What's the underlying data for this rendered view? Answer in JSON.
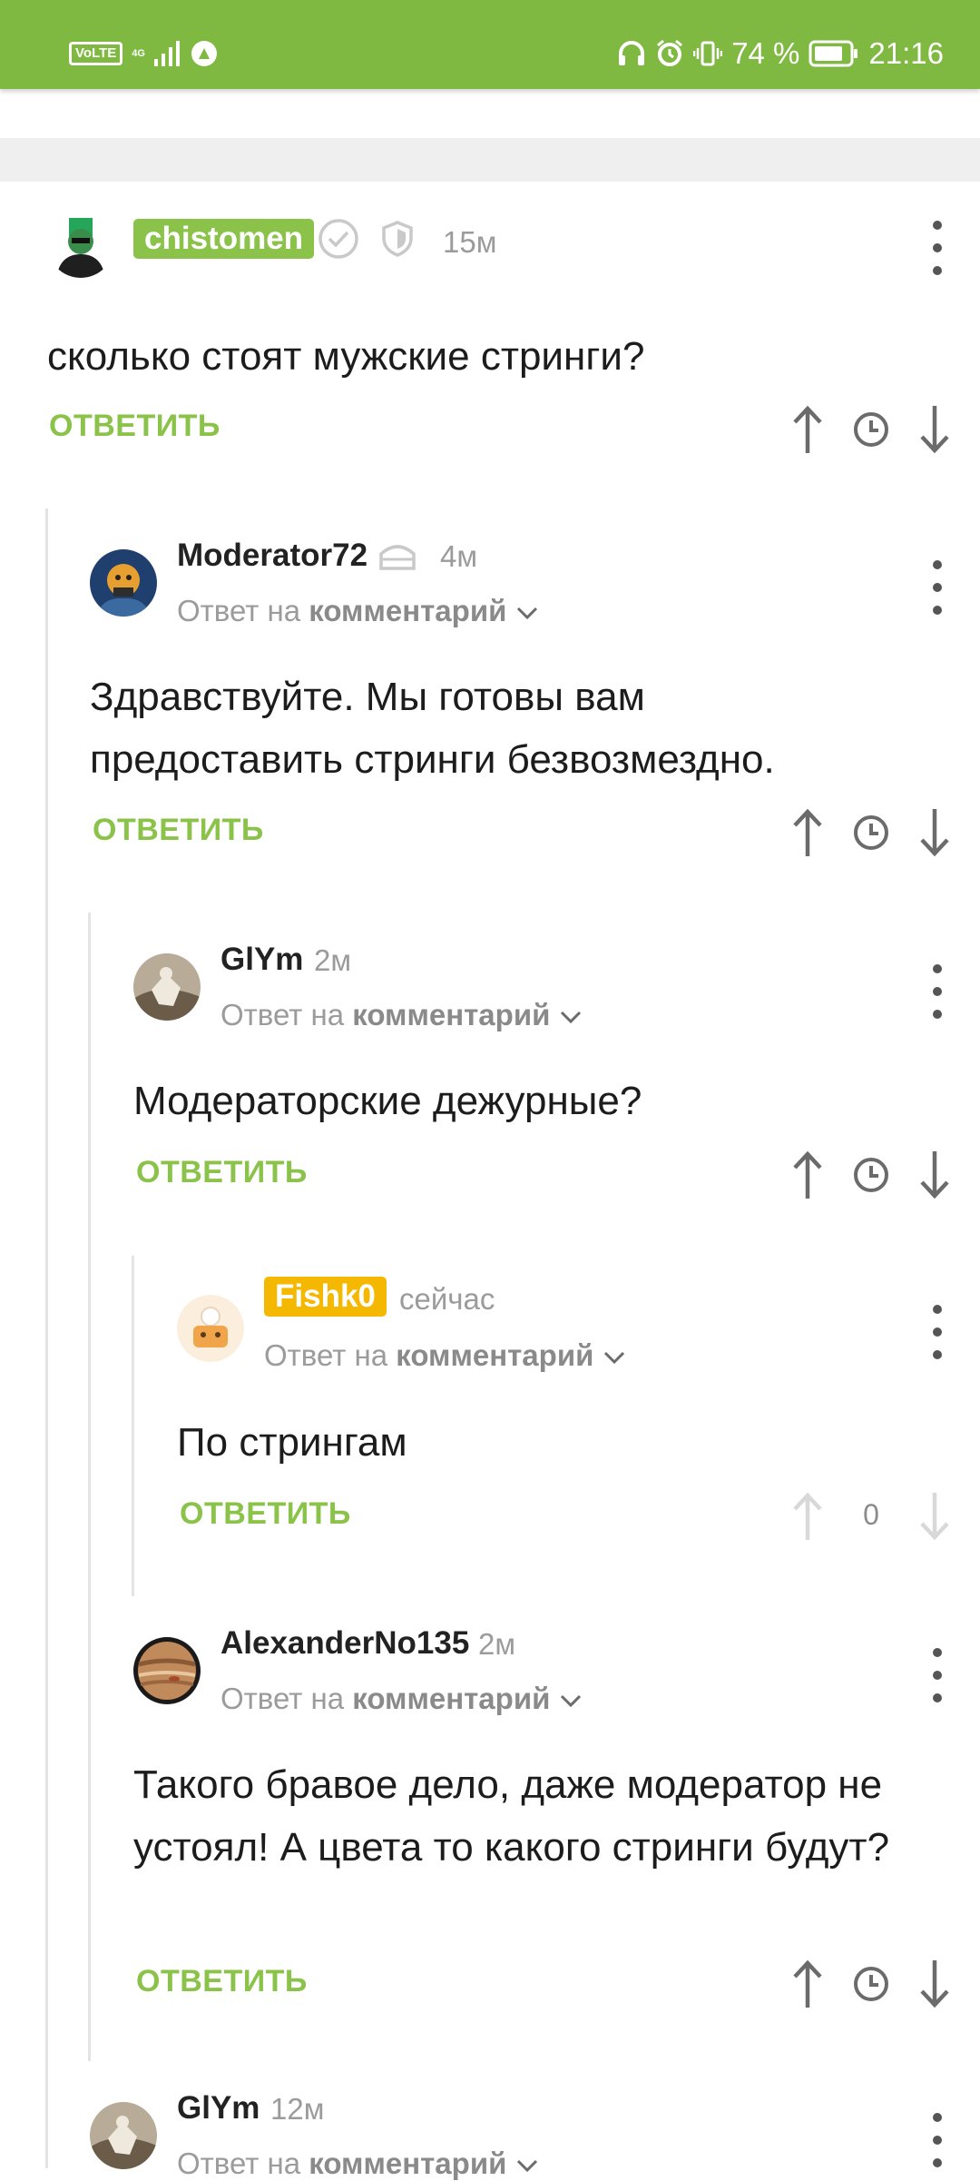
{
  "status_bar": {
    "volte": "VoLTE",
    "network": "4G",
    "battery": "74 %",
    "time": "21:16"
  },
  "comments": [
    {
      "username": "chistomen",
      "time": "15м",
      "text": "сколько стоят мужские стринги?",
      "reply": "ОТВЕТИТЬ",
      "badge_color": "#8bc34a"
    },
    {
      "username": "Moderator72",
      "time": "4м",
      "reply_to_prefix": "Ответ на",
      "reply_to_link": "комментарий",
      "text": "Здравствуйте. Мы готовы вам предоставить стринги безвозмездно.",
      "reply": "ОТВЕТИТЬ"
    },
    {
      "username": "GlYm",
      "time": "2м",
      "reply_to_prefix": "Ответ на",
      "reply_to_link": "комментарий",
      "text": "Модераторские дежурные?",
      "reply": "ОТВЕТИТЬ"
    },
    {
      "username": "Fishk0",
      "time": "сейчас",
      "reply_to_prefix": "Ответ на",
      "reply_to_link": "комментарий",
      "text": "По стрингам",
      "reply": "ОТВЕТИТЬ",
      "score": "0",
      "badge_color": "#f5b800"
    },
    {
      "username": "AlexanderNo135",
      "time": "2м",
      "reply_to_prefix": "Ответ на",
      "reply_to_link": "комментарий",
      "text": "Такого бравое дело, даже модератор не устоял! А цвета то какого стринги будут?",
      "reply": "ОТВЕТИТЬ"
    },
    {
      "username": "GlYm",
      "time": "12м",
      "reply_to_prefix": "Ответ на",
      "reply_to_link": "комментарий"
    }
  ],
  "colors": {
    "status_bar": "#7fb942",
    "accent": "#8bc34a"
  }
}
